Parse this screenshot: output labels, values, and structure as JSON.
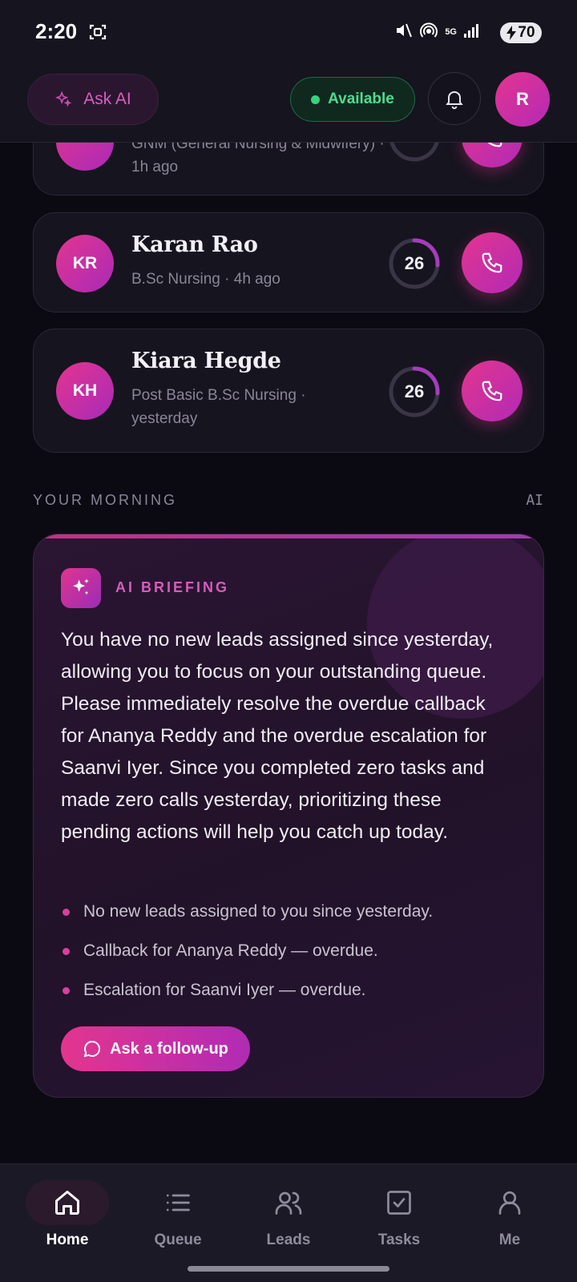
{
  "status_bar": {
    "time": "2:20",
    "network": "5G",
    "battery": "70"
  },
  "header": {
    "ask_ai_label": "Ask AI",
    "availability_label": "Available",
    "avatar_initial": "R"
  },
  "leads": [
    {
      "initials": "",
      "name": "",
      "subtitle": "GNM (General Nursing & Midwifery) · 1h ago",
      "score": ""
    },
    {
      "initials": "KR",
      "name": "Karan Rao",
      "subtitle": "B.Sc Nursing · 4h ago",
      "score": "26",
      "score_fraction": 0.26
    },
    {
      "initials": "KH",
      "name": "Kiara Hegde",
      "subtitle": "Post Basic B.Sc Nursing · yesterday",
      "score": "26",
      "score_fraction": 0.26
    }
  ],
  "morning": {
    "section_title": "YOUR MORNING",
    "section_tag": "AI",
    "briefing_label": "AI BRIEFING",
    "briefing_text": "You have no new leads assigned since yesterday, allowing you to focus on your outstanding queue. Please immediately resolve the overdue callback for Ananya Reddy and the overdue escalation for Saanvi Iyer. Since you completed zero tasks and made zero calls yesterday, prioritizing these pending actions will help you catch up today.",
    "bullets": [
      "No new leads assigned to you since yesterday.",
      "Callback for Ananya Reddy — overdue.",
      "Escalation for Saanvi Iyer — overdue."
    ],
    "followup_label": "Ask a follow-up"
  },
  "nav": {
    "items": [
      {
        "label": "Home",
        "icon": "home-icon"
      },
      {
        "label": "Queue",
        "icon": "list-icon"
      },
      {
        "label": "Leads",
        "icon": "users-icon"
      },
      {
        "label": "Tasks",
        "icon": "checkbox-icon"
      },
      {
        "label": "Me",
        "icon": "user-icon"
      }
    ],
    "active": "Home"
  },
  "colors": {
    "accent_pink": "#e3358f",
    "accent_purple": "#b12bb4",
    "available_green": "#4fdc8f",
    "background": "#0b0a13"
  }
}
